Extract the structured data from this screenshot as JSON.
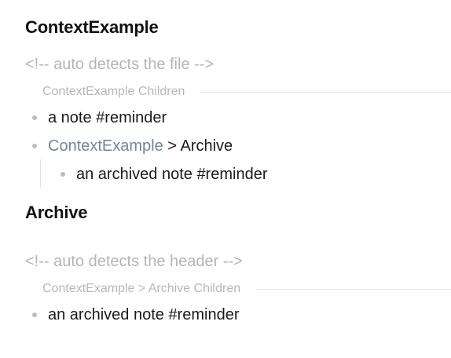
{
  "sections": [
    {
      "heading": "ContextExample",
      "comment": "<!-- auto detects the file -->",
      "children_label": "ContextExample Children",
      "items": [
        {
          "text": "a note #reminder"
        },
        {
          "link": "ContextExample",
          "suffix": " > Archive"
        }
      ],
      "nested_items": [
        {
          "text": "an archived note #reminder"
        }
      ]
    },
    {
      "heading": "Archive",
      "comment": "<!-- auto detects the header -->",
      "children_label": "ContextExample > Archive Children",
      "items": [
        {
          "text": "an archived note #reminder"
        }
      ]
    }
  ]
}
